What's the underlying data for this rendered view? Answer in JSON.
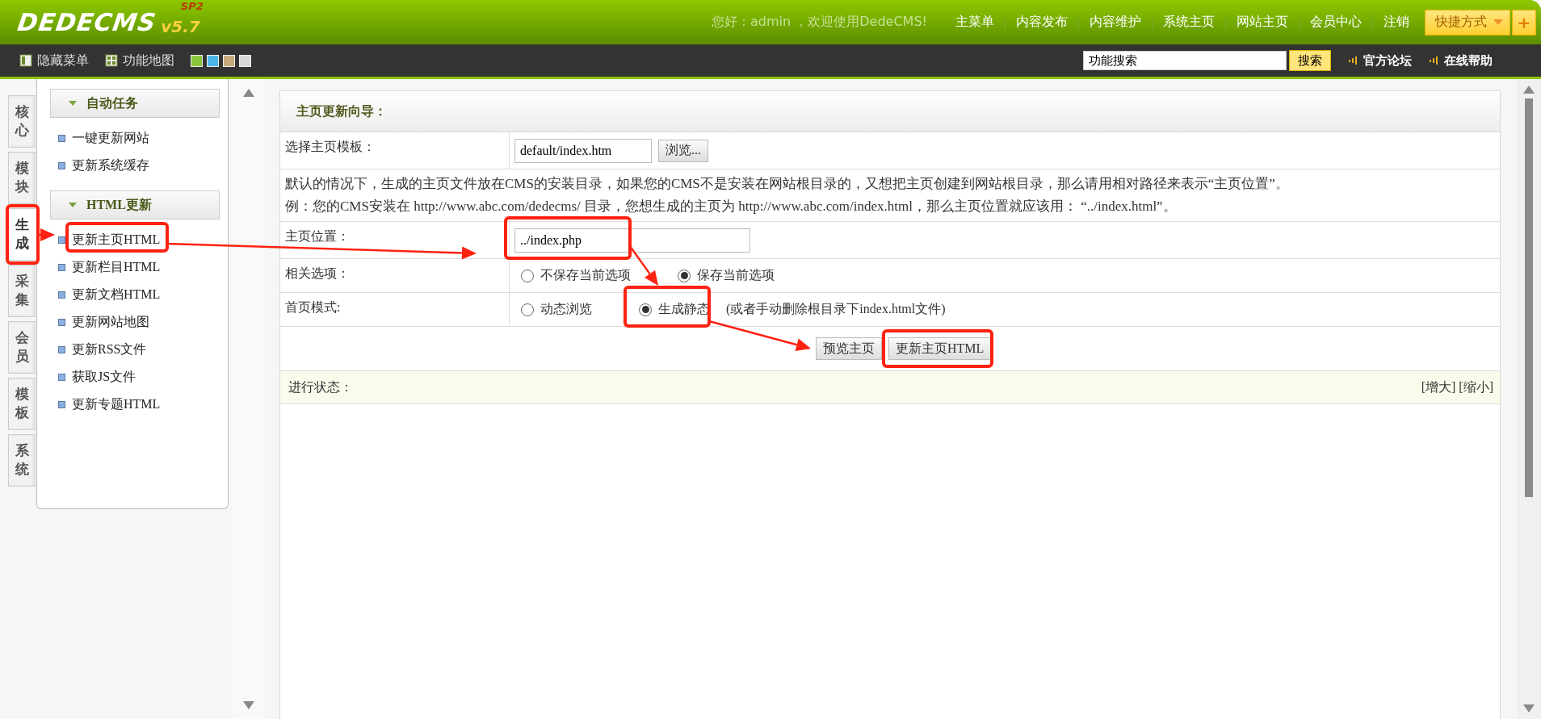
{
  "logo": {
    "name": "DEDECMS",
    "version": "v5.7",
    "edition": "SP2"
  },
  "greeting": "您好：admin ，欢迎使用DedeCMS!",
  "top_menu": [
    "主菜单",
    "内容发布",
    "内容维护",
    "系统主页",
    "网站主页",
    "会员中心",
    "注销"
  ],
  "shortcut": {
    "label": "快捷方式",
    "add": "+"
  },
  "toolbar": {
    "hide_menu": "隐藏菜单",
    "function_map": "功能地图",
    "skins": [
      {
        "color": "#8cc63e"
      },
      {
        "color": "#4db5e8"
      },
      {
        "color": "#c8ab7e"
      },
      {
        "color": "#d8d8d8"
      }
    ],
    "search": {
      "value": "功能搜索",
      "button": "搜索"
    },
    "links": [
      "官方论坛",
      "在线帮助"
    ]
  },
  "side_tabs": [
    {
      "label": "核心",
      "selected": false
    },
    {
      "label": "模块",
      "selected": false
    },
    {
      "label": "生成",
      "selected": true
    },
    {
      "label": "采集",
      "selected": false
    },
    {
      "label": "会员",
      "selected": false
    },
    {
      "label": "模板",
      "selected": false
    },
    {
      "label": "系统",
      "selected": false
    }
  ],
  "sidebar": {
    "groups": [
      {
        "title": "自动任务",
        "expanded": true,
        "items": [
          "一键更新网站",
          "更新系统缓存"
        ]
      },
      {
        "title": "HTML更新",
        "expanded": true,
        "items": [
          "更新主页HTML",
          "更新栏目HTML",
          "更新文档HTML",
          "更新网站地图",
          "更新RSS文件",
          "获取JS文件",
          "更新专题HTML"
        ]
      }
    ]
  },
  "form": {
    "title": "主页更新向导：",
    "template": {
      "label": "选择主页模板：",
      "value": "default/index.htm",
      "browse": "浏览..."
    },
    "notes": [
      "默认的情况下，生成的主页文件放在CMS的安装目录，如果您的CMS不是安装在网站根目录的，又想把主页创建到网站根目录，那么请用相对路径来表示“主页位置”。",
      "例：您的CMS安装在 http://www.abc.com/dedecms/ 目录，您想生成的主页为 http://www.abc.com/index.html，那么主页位置就应该用： “../index.html”。"
    ],
    "location": {
      "label": "主页位置：",
      "value": "../index.php"
    },
    "options": {
      "label": "相关选项：",
      "choices": [
        {
          "label": "不保存当前选项",
          "selected": false
        },
        {
          "label": "保存当前选项",
          "selected": true
        }
      ]
    },
    "mode": {
      "label": "首页模式:",
      "choices": [
        {
          "label": "动态浏览",
          "selected": false
        },
        {
          "label": "生成静态",
          "selected": true
        }
      ],
      "hint": "(或者手动删除根目录下index.html文件)"
    },
    "buttons": [
      "预览主页",
      "更新主页HTML"
    ]
  },
  "status": {
    "label": "进行状态：",
    "links": [
      "[增大]",
      "[缩小]"
    ]
  },
  "annotation_marks": true
}
